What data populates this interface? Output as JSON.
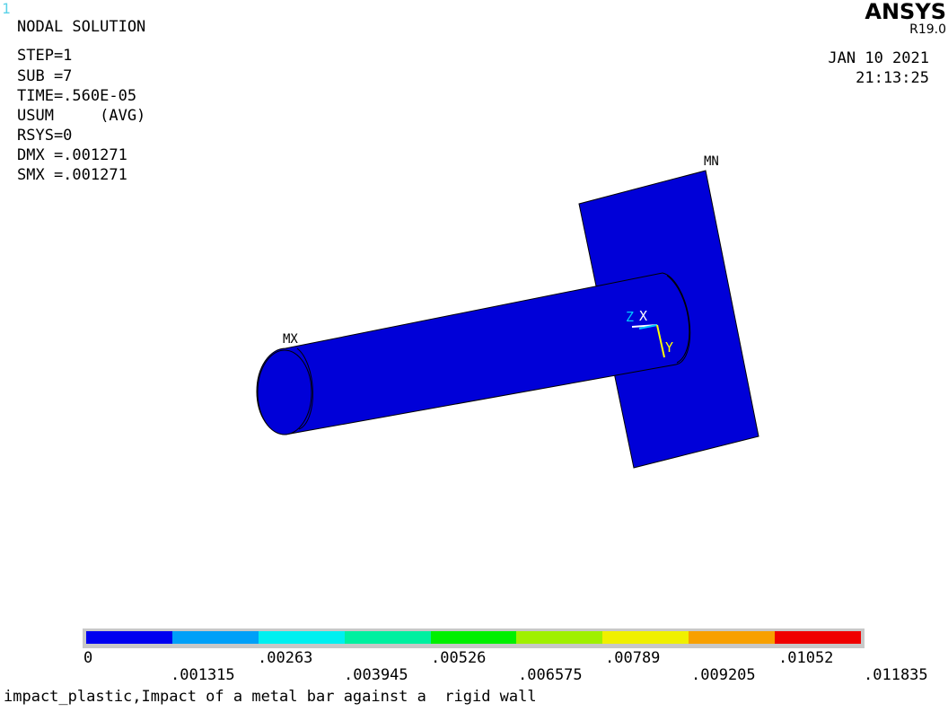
{
  "window_number": "1",
  "header": {
    "title": "NODAL SOLUTION",
    "step": "STEP=1",
    "sub": "SUB =7",
    "time": "TIME=.560E-05",
    "usum": "USUM     (AVG)",
    "rsys": "RSYS=0",
    "dmx": "DMX =.001271",
    "smx": "SMX =.001271"
  },
  "logo": {
    "brand": "ANSYS",
    "version": "R19.0"
  },
  "date": "JAN 10 2021",
  "time_of_day": "21:13:25",
  "model_labels": {
    "mx": "MX",
    "mn": "MN"
  },
  "triad": {
    "x": "X",
    "y": "Y",
    "z": "Z"
  },
  "legend": {
    "colors": [
      "#0000f0",
      "#00a0f8",
      "#00f0f0",
      "#00f0a0",
      "#00f000",
      "#a0f000",
      "#f0f000",
      "#f8a000",
      "#f00000"
    ],
    "ticks_top": [
      "0",
      ".00263",
      ".00526",
      ".00789",
      ".01052"
    ],
    "ticks_bottom": [
      ".001315",
      ".003945",
      ".006575",
      ".009205",
      ".011835"
    ]
  },
  "colors": {
    "model_fill": "#0000d8",
    "model_edge": "#000000",
    "triad_x": "#ffffff",
    "triad_y": "#ffff00",
    "triad_z": "#00c8ff"
  },
  "caption": "impact_plastic,Impact of a metal bar against a  rigid wall"
}
